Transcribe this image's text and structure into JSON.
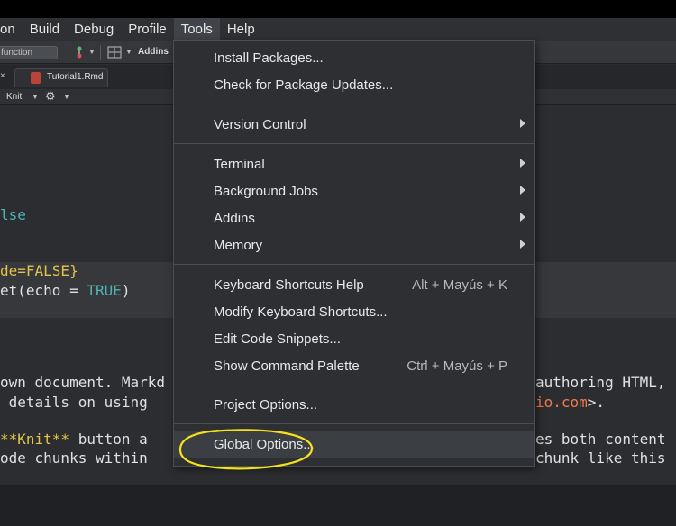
{
  "menubar": {
    "items": [
      "on",
      "Build",
      "Debug",
      "Profile",
      "Tools",
      "Help"
    ],
    "active": "Tools"
  },
  "toolbar": {
    "goto_text": "function",
    "addins_label": "Addins"
  },
  "tabs": {
    "close_glyph": "×",
    "active_tab": "Tutorial1.Rmd"
  },
  "editor_toolbar": {
    "knit_label": "Knit"
  },
  "editor": {
    "lines": {
      "l1": "lse",
      "l2": "de=FALSE}",
      "l3_a": "et(echo = ",
      "l3_b": "TRUE",
      "l3_c": ")",
      "l4": "own document. Markd",
      "l4_right": "authoring HTML,",
      "l5": " details on using ",
      "l5_link": "io.com",
      "l5_end": ">.",
      "l6_a": "**Knit**",
      "l6_b": " button a",
      "l6_right": "es both content",
      "l7": "ode chunks within ",
      "l7_right": "chunk like this"
    }
  },
  "tools_menu": {
    "install_packages": "Install Packages...",
    "check_updates": "Check for Package Updates...",
    "version_control": "Version Control",
    "terminal": "Terminal",
    "background_jobs": "Background Jobs",
    "addins": "Addins",
    "memory": "Memory",
    "keyboard_shortcuts_help": "Keyboard Shortcuts Help",
    "keyboard_shortcuts_help_key": "Alt + Mayús + K",
    "modify_keyboard_shortcuts": "Modify Keyboard Shortcuts...",
    "edit_code_snippets": "Edit Code Snippets...",
    "show_command_palette": "Show Command Palette",
    "show_command_palette_key": "Ctrl + Mayús + P",
    "project_options": "Project Options...",
    "global_options": "Global Options..."
  },
  "colors": {
    "highlight_circle": "#f5e21a",
    "menu_bg": "#2d2f32",
    "editor_bg": "#2b2d30"
  }
}
